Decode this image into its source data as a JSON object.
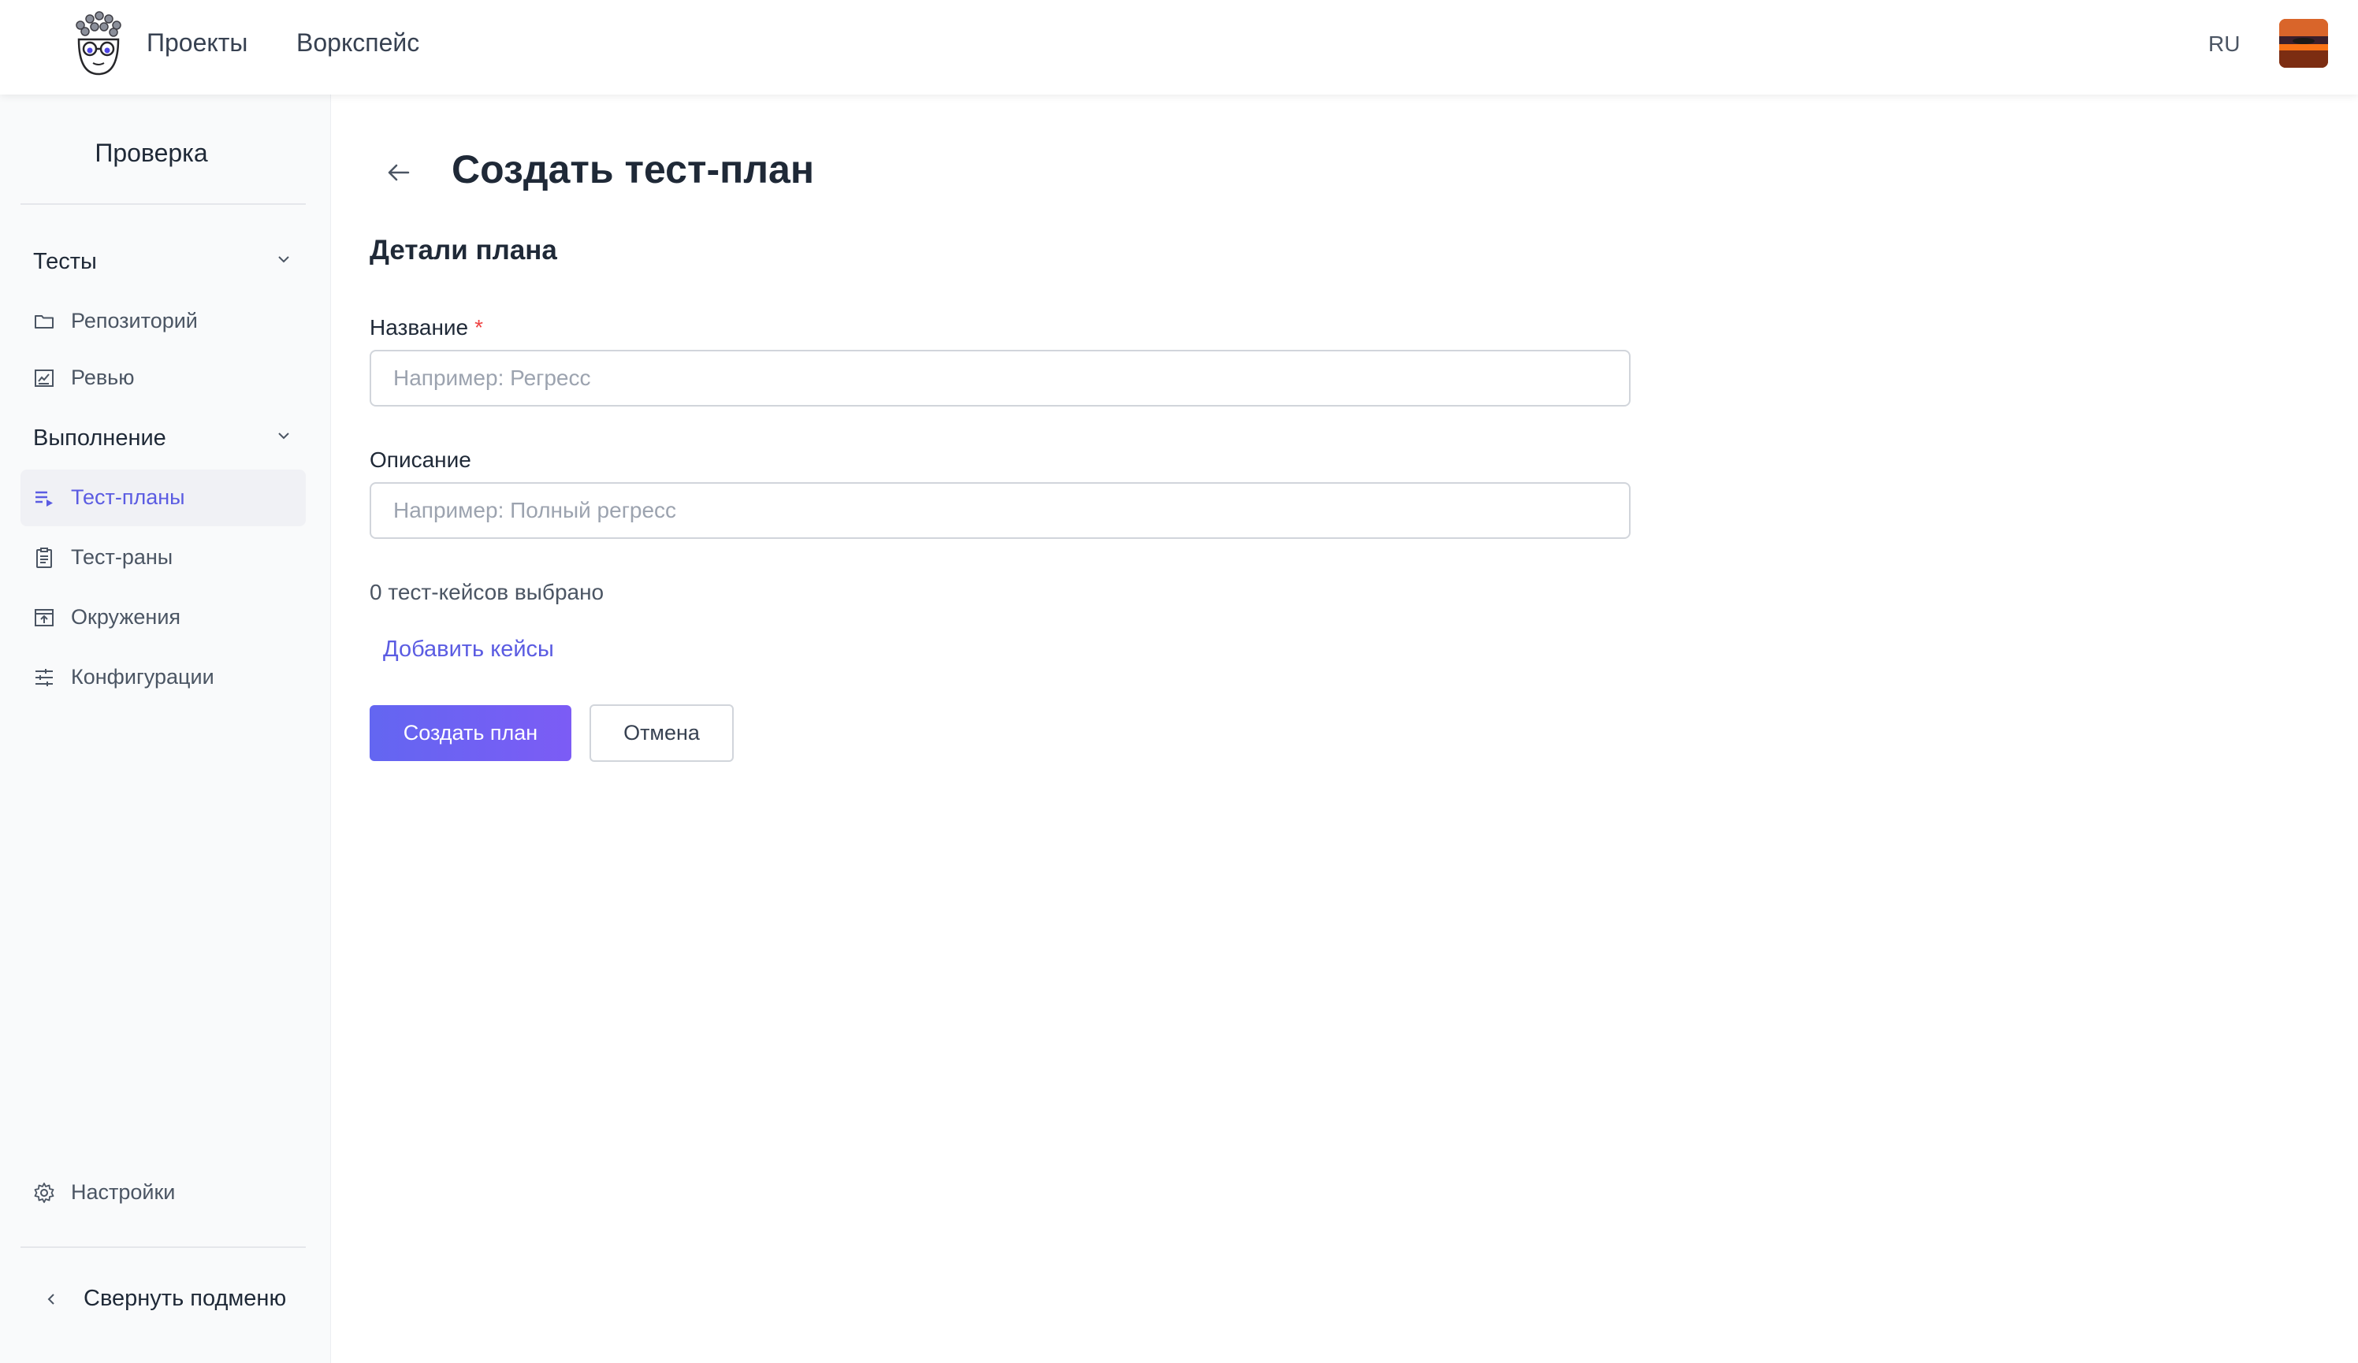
{
  "header": {
    "nav": {
      "projects": "Проекты",
      "workspace": "Воркспейс"
    },
    "lang": "RU",
    "icons": {
      "logo": "bug-mascot-logo",
      "avatar": "user-avatar"
    }
  },
  "sidebar": {
    "title": "Проверка",
    "groups": [
      {
        "label": "Тесты",
        "icon": "chevron-down-icon",
        "items": [
          {
            "label": "Репозиторий",
            "icon": "folder-icon"
          },
          {
            "label": "Ревью",
            "icon": "review-icon"
          }
        ]
      },
      {
        "label": "Выполнение",
        "icon": "chevron-down-icon",
        "items": [
          {
            "label": "Тест-планы",
            "icon": "playlist-icon",
            "active": true
          },
          {
            "label": "Тест-раны",
            "icon": "clipboard-icon"
          },
          {
            "label": "Окружения",
            "icon": "environment-icon"
          },
          {
            "label": "Конфигурации",
            "icon": "sliders-icon"
          }
        ]
      }
    ],
    "settings": {
      "label": "Настройки",
      "icon": "gear-icon"
    },
    "collapse": {
      "label": "Свернуть подменю",
      "icon": "chevron-left-icon"
    }
  },
  "page": {
    "title": "Создать тест-план",
    "section_title": "Детали плана",
    "form": {
      "name_label": "Название",
      "required_mark": "*",
      "name_placeholder": "Например: Регресс",
      "name_value": "",
      "description_label": "Описание",
      "description_placeholder": "Например: Полный регресс",
      "description_value": ""
    },
    "selected_count_text": "0 тест-кейсов выбрано",
    "add_cases_link": "Добавить кейсы",
    "buttons": {
      "create": "Создать план",
      "cancel": "Отмена"
    }
  },
  "colors": {
    "accent": "#5b5ce2",
    "primary_button_from": "#6366f1",
    "primary_button_to": "#7c5cf5",
    "required": "#ef4444",
    "sidebar_bg": "#f9fafb",
    "active_item_bg": "#f0f1f5"
  }
}
